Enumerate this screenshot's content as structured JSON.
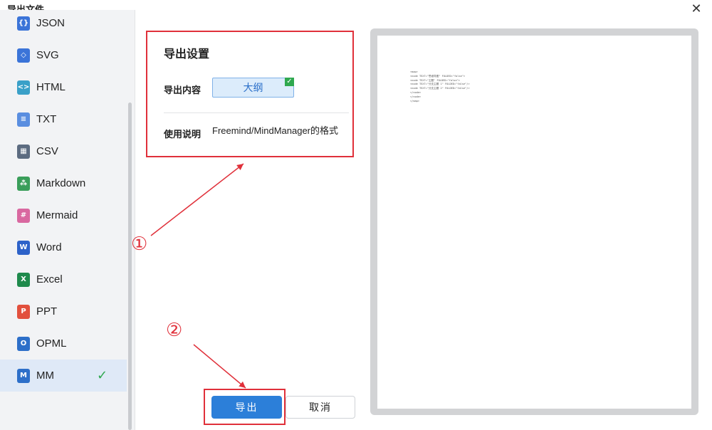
{
  "window": {
    "title": "导出文件",
    "close_label": "✕"
  },
  "sidebar": {
    "items": [
      {
        "label": "JSON",
        "icon": "json-icon",
        "glyph": "{}",
        "color": "#3b74d8"
      },
      {
        "label": "SVG",
        "icon": "svg-icon",
        "glyph": "◇",
        "color": "#3b74d8"
      },
      {
        "label": "HTML",
        "icon": "html-icon",
        "glyph": "<>",
        "color": "#3aa0c8"
      },
      {
        "label": "TXT",
        "icon": "txt-icon",
        "glyph": "≡",
        "color": "#5a8ee0"
      },
      {
        "label": "CSV",
        "icon": "csv-icon",
        "glyph": "▦",
        "color": "#5c6b80"
      },
      {
        "label": "Markdown",
        "icon": "markdown-icon",
        "glyph": "⁂",
        "color": "#3a9e5a"
      },
      {
        "label": "Mermaid",
        "icon": "mermaid-icon",
        "glyph": "#",
        "color": "#d968a0"
      },
      {
        "label": "Word",
        "icon": "word-icon",
        "glyph": "W",
        "color": "#2d62c9"
      },
      {
        "label": "Excel",
        "icon": "excel-icon",
        "glyph": "X",
        "color": "#1f8a4c"
      },
      {
        "label": "PPT",
        "icon": "ppt-icon",
        "glyph": "P",
        "color": "#e2503d"
      },
      {
        "label": "OPML",
        "icon": "opml-icon",
        "glyph": "O",
        "color": "#2d6fc9"
      },
      {
        "label": "MM",
        "icon": "mm-icon",
        "glyph": "M",
        "color": "#2d6fc9",
        "selected": true,
        "check": "✓"
      }
    ]
  },
  "settings": {
    "title": "导出设置",
    "content_label": "导出内容",
    "content_value": "大纲",
    "badge": "✓",
    "usage_label": "使用说明",
    "usage_value": "Freemind/MindManager的格式"
  },
  "annotations": {
    "one": "①",
    "two": "②"
  },
  "actions": {
    "export": "导出",
    "cancel": "取消"
  },
  "preview": {
    "lines": [
      "<map>",
      "<node TEXT=\"思维导图\" FOLDED=\"false\">",
      "<node TEXT=\"主题\" FOLDED=\"false\">",
      "<node TEXT=\"分支主题 1\" FOLDED=\"false\"/>",
      "<node TEXT=\"分支主题 2\" FOLDED=\"false\"/>",
      "</node>",
      "</node>",
      "</map>"
    ],
    "colors": {
      "frame": "#d2d3d5",
      "page": "#ffffff"
    }
  },
  "colors": {
    "accent": "#2c7fd9",
    "annotation": "#e0303a",
    "check": "#2fa84f"
  }
}
